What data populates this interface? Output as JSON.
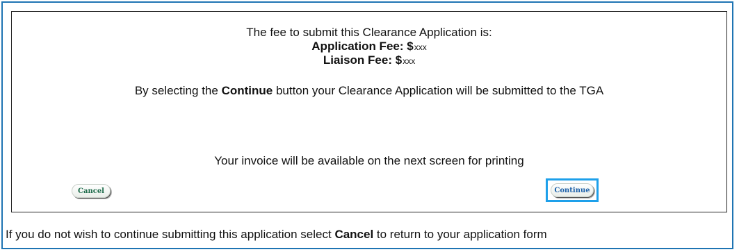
{
  "fee": {
    "intro": "The fee to submit this Clearance Application is:",
    "application_label": "Application Fee: $",
    "application_amount": "xxx",
    "liaison_label": "Liaison Fee: $",
    "liaison_amount": "xxx"
  },
  "submit_note": {
    "before": "By selecting the ",
    "bold": "Continue",
    "after": " button your Clearance Application will be submitted to the TGA"
  },
  "invoice_note": "Your invoice will be available on the next screen for printing",
  "buttons": {
    "cancel_label": "Cancel",
    "continue_label": "Continue"
  },
  "footer_note": {
    "before": "If you do not wish to continue submitting this application select ",
    "bold": "Cancel",
    "after": " to return to your application form"
  },
  "colors": {
    "frame_border": "#1e74b3",
    "continue_highlight": "#1ea0ea",
    "button_text": "#1d6b4a"
  }
}
